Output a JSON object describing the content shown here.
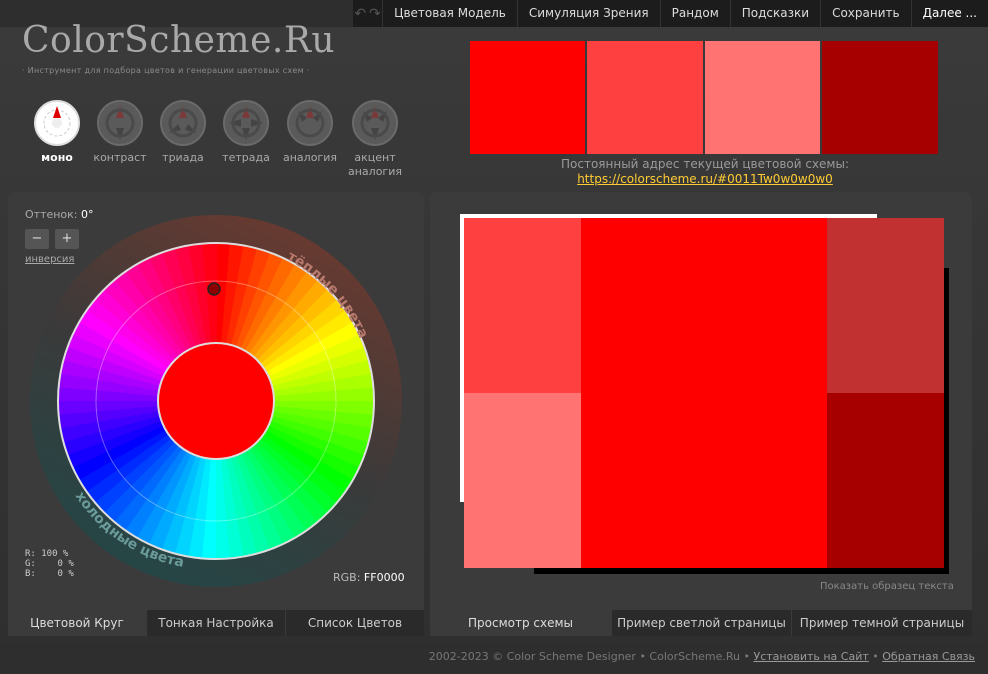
{
  "topbar": {
    "items": [
      "Цветовая Модель",
      "Симуляция Зрения",
      "Рандом",
      "Подсказки",
      "Сохранить",
      "Далее ..."
    ]
  },
  "logo": "ColorScheme.Ru",
  "tagline": "· Инструмент для подбора цветов и генерации цветовых схем ·",
  "modes": [
    {
      "label": "моно",
      "active": true
    },
    {
      "label": "контраст",
      "active": false
    },
    {
      "label": "триада",
      "active": false
    },
    {
      "label": "тетрада",
      "active": false
    },
    {
      "label": "аналогия",
      "active": false
    },
    {
      "label": "акцент аналогия",
      "active": false
    }
  ],
  "swatches": [
    "#ff0000",
    "#ff4040",
    "#ff7373",
    "#a60000"
  ],
  "permalink": {
    "label": "Постоянный адрес текущей цветовой схемы:",
    "url": "https://colorscheme.ru/#0011Tw0w0w0w0"
  },
  "wheel": {
    "hue_label": "Оттенок:",
    "hue_value": "0°",
    "minus": "−",
    "plus": "+",
    "inversion": "инверсия",
    "warm": "тёплые цвета",
    "cold": "холодные цвета",
    "rgb_pct": [
      "R: 100 %",
      "G:    0 %",
      "B:    0 %"
    ],
    "rgb_label": "RGB:",
    "rgb_hex": "FF0000"
  },
  "left_tabs": [
    "Цветовой Круг",
    "Тонкая Настройка",
    "Список Цветов"
  ],
  "right_tabs": [
    "Просмотр схемы",
    "Пример светлой страницы",
    "Пример темной страницы"
  ],
  "preview": {
    "show_text": "Показать образец текста",
    "tl": "#ff4040",
    "bl": "#ff7373",
    "center": "#ff0000",
    "tr": "#c23131",
    "br": "#a60000"
  },
  "footer": {
    "copyright": "2002-2023 © Color Scheme Designer • ColorScheme.Ru •",
    "install": "Установить на Сайт",
    "sep": "•",
    "feedback": "Обратная Связь"
  }
}
